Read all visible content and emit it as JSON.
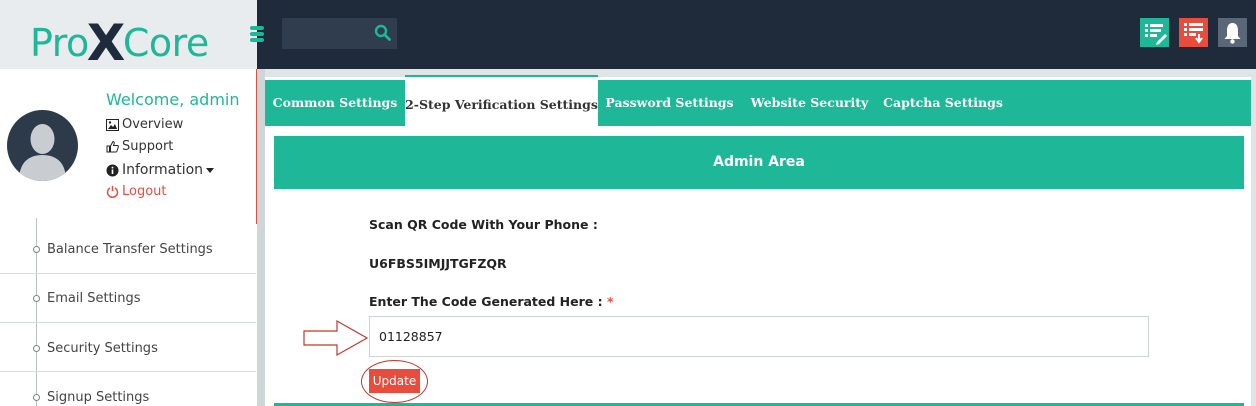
{
  "brand": {
    "logo_left": "Pro",
    "logo_x": "X",
    "logo_right": "Core"
  },
  "search": {
    "placeholder": ""
  },
  "profile": {
    "welcome": "Welcome, admin",
    "links": [
      {
        "label": "Overview",
        "icon": "image-icon"
      },
      {
        "label": "Support",
        "icon": "thumbs-up-icon"
      },
      {
        "label": "Information",
        "icon": "info-icon"
      },
      {
        "label": "Logout",
        "icon": "power-icon"
      }
    ]
  },
  "sidebar": {
    "items": [
      {
        "label": "Balance Transfer Settings"
      },
      {
        "label": "Email Settings"
      },
      {
        "label": "Security Settings"
      },
      {
        "label": "Signup Settings"
      }
    ]
  },
  "tabs": [
    {
      "label": "Common Settings"
    },
    {
      "label": "2-Step Verification Settings"
    },
    {
      "label": "Password Settings"
    },
    {
      "label": "Website Security"
    },
    {
      "label": "Captcha Settings"
    }
  ],
  "panel": {
    "header": "Admin Area",
    "qr_label": "Scan QR Code With Your Phone :",
    "secret_key": "U6FBS5IMJJTGFZQR",
    "code_label": "Enter The Code Generated Here :",
    "required_mark": "*",
    "code_value": "01128857",
    "update_label": "Update"
  },
  "colors": {
    "accent": "#1eb798",
    "danger": "#e74c3c",
    "topbar": "#1f2b3a"
  }
}
